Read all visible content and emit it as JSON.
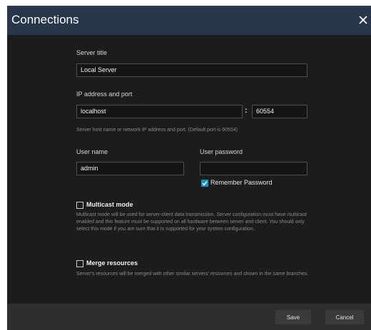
{
  "dialog": {
    "title": "Connections"
  },
  "server_title": {
    "label": "Server title",
    "value": "Local Server"
  },
  "address": {
    "label": "IP address and port",
    "host_value": "localhost",
    "separator": ":",
    "port_value": "60554",
    "hint": "Server host name or network IP address and port. (Default port is 60554)"
  },
  "credentials": {
    "username_label": "User name",
    "username_value": "admin",
    "password_label": "User password",
    "password_value": "",
    "remember_label": "Remember Password",
    "remember_checked": true
  },
  "multicast": {
    "label": "Multicast mode",
    "checked": false,
    "description": "Multicast mode will be used for server-client data transmission. Server configuration must have multicast enabled and this feature must be supported on all hardware between server and client. You should only select this mode if you are sure that it is supported for your system configuration."
  },
  "merge": {
    "label": "Merge resources",
    "checked": false,
    "description": "Server's resources will be merged with other similar servers' resources and shown in the same branches."
  },
  "footer": {
    "save_label": "Save",
    "cancel_label": "Cancel"
  },
  "colors": {
    "titlebar": "#27364a",
    "background": "#1c1c1c",
    "footer": "#2e2e2e",
    "accent": "#1f8fc2"
  },
  "icons": {
    "close": "close-icon",
    "check": "checkmark-icon"
  }
}
